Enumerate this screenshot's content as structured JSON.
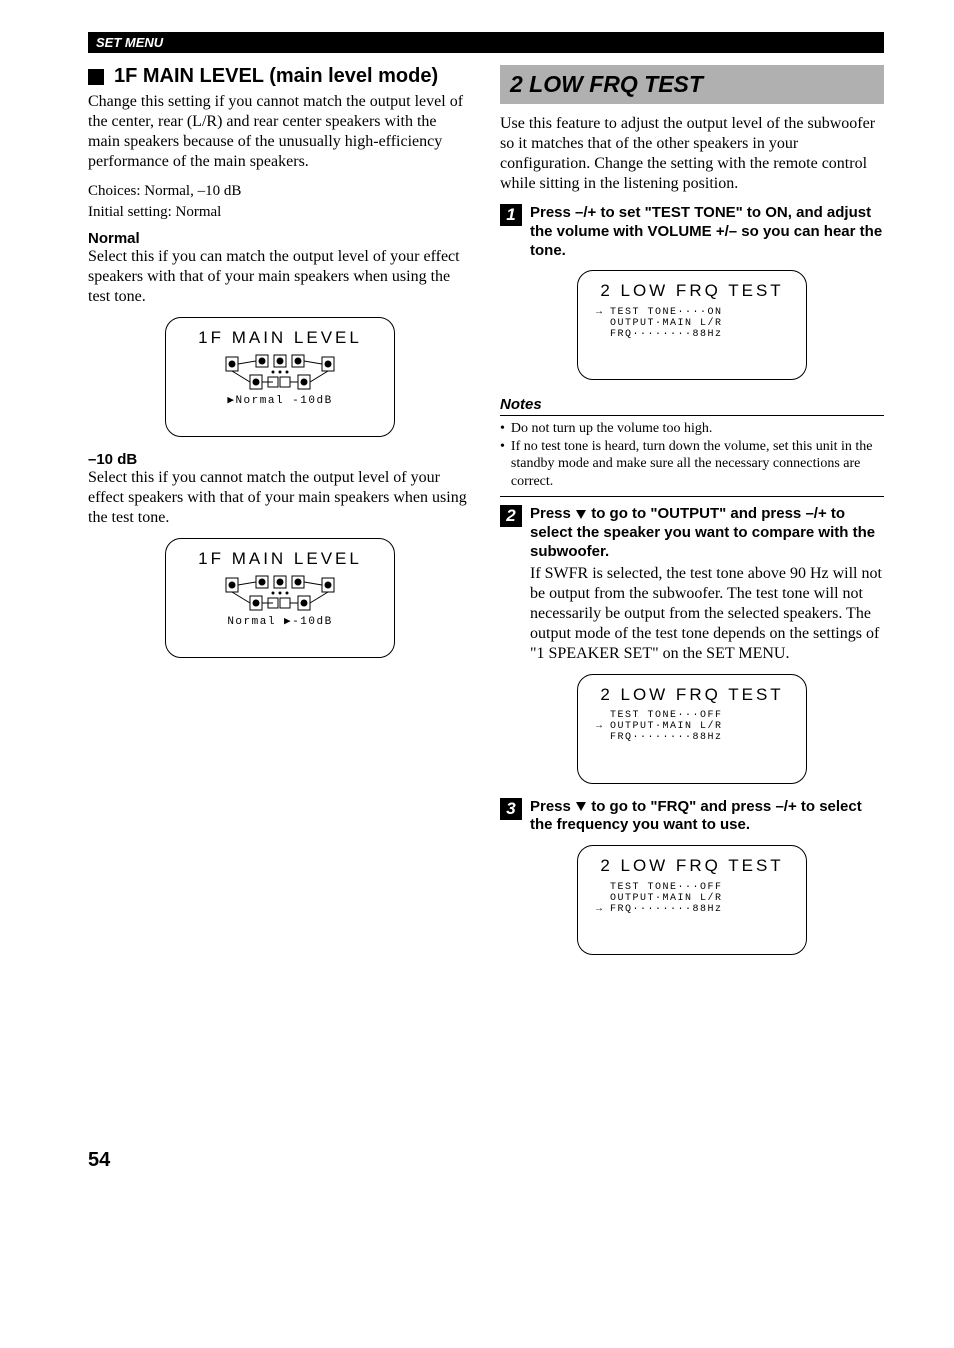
{
  "header": {
    "bar": "SET MENU"
  },
  "left": {
    "heading": "1F MAIN LEVEL (main level mode)",
    "intro": "Change this setting if you cannot match the output level of the center, rear (L/R) and rear center speakers with the main speakers because of the unusually high-efficiency performance of the main speakers.",
    "choices": "Choices: Normal, –10 dB",
    "initial": "Initial setting: Normal",
    "normal_label": "Normal",
    "normal_body": "Select this if you can match the output level of your effect speakers with that of your main speakers when using the test tone.",
    "minus10_label": "–10 dB",
    "minus10_body": "Select this if you cannot match the output level of your effect speakers with that of your main speakers when using the test tone.",
    "lcd1": {
      "title": "1F MAIN LEVEL",
      "opts": "▶Normal   -10dB"
    },
    "lcd2": {
      "title": "1F MAIN LEVEL",
      "opts": " Normal  ▶-10dB"
    }
  },
  "right": {
    "banner": "2  LOW FRQ TEST",
    "intro": "Use this feature to adjust the output level of the subwoofer so it matches that of the other speakers in your configuration. Change the setting with the remote control while sitting in the listening position.",
    "step1_num": "1",
    "step1_instr": "Press –/+ to set \"TEST TONE\" to ON, and adjust the volume with VOLUME +/– so you can hear the tone.",
    "lcd_s1": {
      "title": "2 LOW FRQ TEST",
      "l1": "TEST TONE····ON",
      "l2": "OUTPUT·MAIN L/R",
      "l3": "FRQ········88Hz",
      "cursor_row": 1
    },
    "notes_label": "Notes",
    "notes": [
      "Do not turn up the volume too high.",
      "If no test tone is heard, turn down the volume, set this unit in the standby mode and make sure all the necessary connections are correct."
    ],
    "step2_num": "2",
    "step2_instr_pre": "Press ",
    "step2_instr_post": " to go to \"OUTPUT\" and press –/+ to select the speaker you want to compare with the subwoofer.",
    "step2_body": "If SWFR is selected, the test tone above 90 Hz will not be output from the subwoofer. The test tone will not necessarily be output from the selected speakers. The output mode of the test tone depends on the settings of \"1 SPEAKER SET\" on the SET MENU.",
    "lcd_s2": {
      "title": "2 LOW FRQ TEST",
      "l1": "TEST TONE···OFF",
      "l2": "OUTPUT·MAIN L/R",
      "l3": "FRQ········88Hz",
      "cursor_row": 2
    },
    "step3_num": "3",
    "step3_instr_pre": "Press ",
    "step3_instr_post": " to go to \"FRQ\" and press –/+ to select the frequency you want to use.",
    "lcd_s3": {
      "title": "2 LOW FRQ TEST",
      "l1": "TEST TONE···OFF",
      "l2": "OUTPUT·MAIN L/R",
      "l3": "FRQ········88Hz",
      "cursor_row": 3
    }
  },
  "page_number": "54"
}
